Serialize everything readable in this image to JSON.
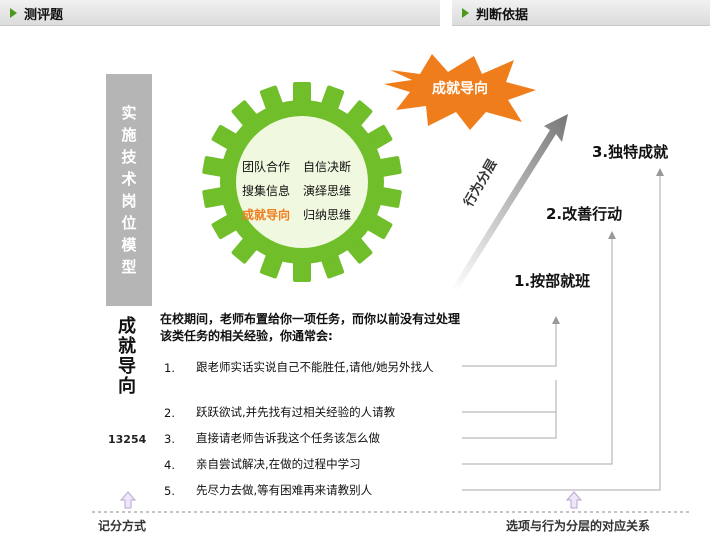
{
  "tabs": {
    "left": "测评题",
    "right": "判断依据"
  },
  "banner": [
    "实",
    "施",
    "技",
    "术",
    "岗",
    "位",
    "",
    "模",
    "型"
  ],
  "side_title": [
    "成",
    "就",
    "导",
    "向"
  ],
  "score": "13254",
  "gear": {
    "rows": [
      [
        "团队合作",
        "自信决断"
      ],
      [
        "搜集信息",
        "演绎思维"
      ],
      [
        "成就导向",
        "归纳思维"
      ]
    ],
    "highlight_color": "#f07d1c"
  },
  "starburst_label": "成就导向",
  "axis_label": "行为分层",
  "levels": [
    "1.按部就班",
    "2.改善行动",
    "3.独特成就"
  ],
  "question": "在校期间，老师布置给你一项任务，而你以前没有过处理该类任务的相关经验，你通常会:",
  "options": [
    {
      "num": "1.",
      "text": "跟老师实话实说自己不能胜任,请他/她另外找人"
    },
    {
      "num": "2.",
      "text": "跃跃欲试,并先找有过相关经验的人请教"
    },
    {
      "num": "3.",
      "text": "直接请老师告诉我这个任务该怎么做"
    },
    {
      "num": "4.",
      "text": "亲自尝试解决,在做的过程中学习"
    },
    {
      "num": "5.",
      "text": "先尽力去做,等有困难再来请教别人"
    }
  ],
  "footer": {
    "left": "记分方式",
    "right": "选项与行为分层的对应关系"
  },
  "colors": {
    "gear_green": "#6fbe2a",
    "gear_inner": "#f0f9e0",
    "star_orange": "#f07d1c",
    "banner_gray": "#b5b5b5"
  }
}
